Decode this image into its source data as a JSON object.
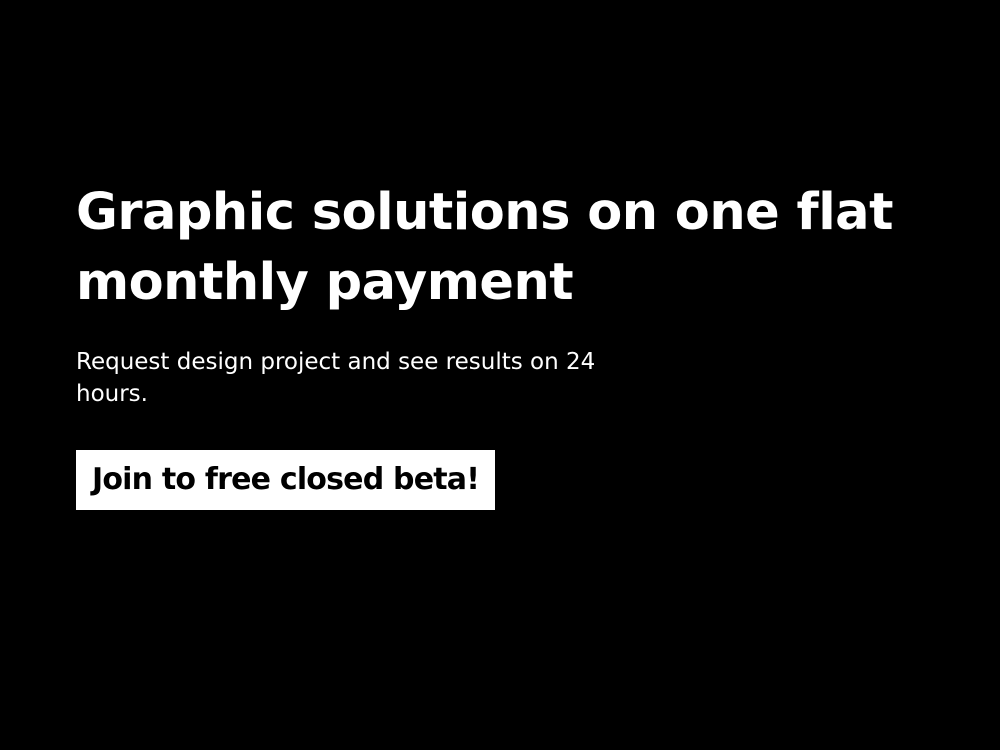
{
  "hero": {
    "headline_line1": "Graphic solutions on one flat",
    "headline_line2": "monthly payment",
    "subtitle_line1": "Request design project and see results on 24",
    "subtitle_line2": "hours.",
    "cta_label": "Join to free closed beta!"
  },
  "colors": {
    "background": "#000000",
    "text": "#ffffff",
    "button_background": "#ffffff",
    "button_text": "#000000"
  }
}
